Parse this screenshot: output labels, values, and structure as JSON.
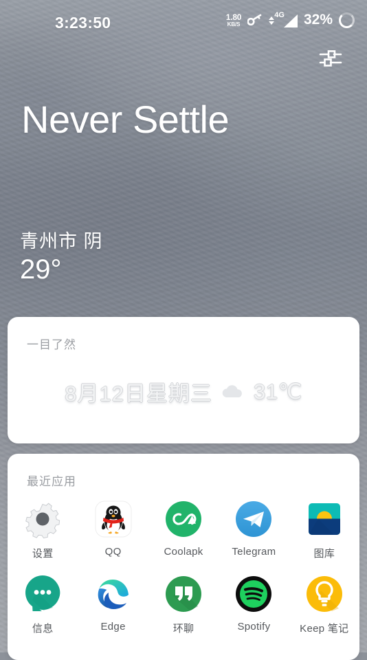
{
  "status_bar": {
    "time": "3:23:50",
    "net_speed_value": "1.80",
    "net_speed_unit": "KB/S",
    "vpn_icon": "key-icon",
    "data_icon": "data-updown-icon",
    "network_type": "4G",
    "signal_icon": "signal-bars-icon",
    "battery_percent": "32%",
    "battery_icon": "battery-ring-icon"
  },
  "header": {
    "settings_icon": "sliders-icon",
    "brand_title": "Never Settle"
  },
  "wallpaper_weather": {
    "location_condition": "青州市  阴",
    "temperature": "29°"
  },
  "glance_card": {
    "title": "一目了然",
    "date": "8月12日星期三",
    "weather_icon": "cloud-icon",
    "temperature": "31℃"
  },
  "recent_apps_card": {
    "title": "最近应用",
    "rows": [
      [
        {
          "label": "设置",
          "icon": "settings-gear-icon"
        },
        {
          "label": "QQ",
          "icon": "qq-penguin-icon"
        },
        {
          "label": "Coolapk",
          "icon": "coolapk-icon"
        },
        {
          "label": "Telegram",
          "icon": "telegram-icon"
        },
        {
          "label": "图库",
          "icon": "gallery-icon"
        }
      ],
      [
        {
          "label": "信息",
          "icon": "messages-icon"
        },
        {
          "label": "Edge",
          "icon": "edge-icon"
        },
        {
          "label": "环聊",
          "icon": "hangouts-icon"
        },
        {
          "label": "Spotify",
          "icon": "spotify-icon"
        },
        {
          "label": "Keep 笔记",
          "icon": "keep-notes-icon"
        }
      ]
    ]
  },
  "colors": {
    "card_background": "#ffffff",
    "status_text": "#ffffff",
    "app_label": "#55585c",
    "card_title": "#9a9da2",
    "glance_text": "#f2f3f4"
  }
}
